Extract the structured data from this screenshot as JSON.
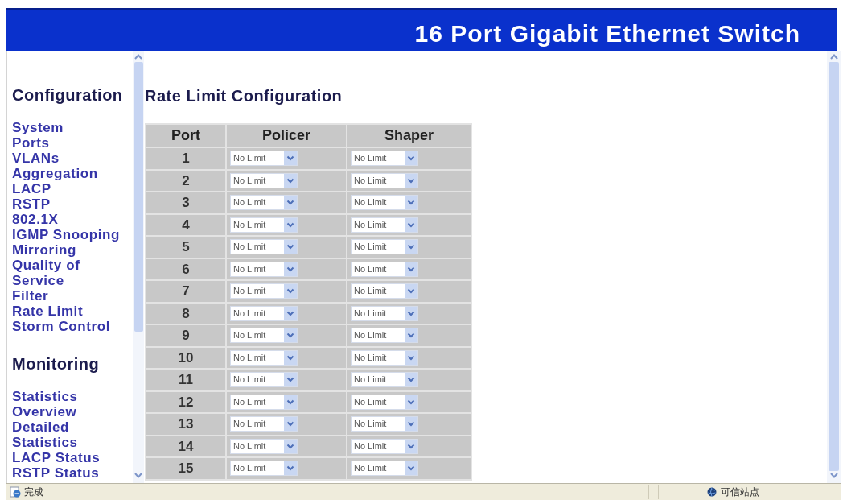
{
  "header": {
    "title": "16 Port Gigabit Ethernet Switch"
  },
  "sidebar": {
    "sections": [
      {
        "heading": "Configuration",
        "items": [
          "System",
          "Ports",
          "VLANs",
          "Aggregation",
          "LACP",
          "RSTP",
          "802.1X",
          "IGMP Snooping",
          "Mirroring",
          "Quality of Service",
          "Filter",
          "Rate Limit",
          "Storm Control"
        ]
      },
      {
        "heading": "Monitoring",
        "items": [
          "Statistics Overview",
          "Detailed Statistics",
          "LACP Status",
          "RSTP Status"
        ]
      }
    ]
  },
  "content": {
    "heading": "Rate Limit Configuration",
    "table": {
      "columns": [
        "Port",
        "Policer",
        "Shaper"
      ],
      "rows": [
        {
          "port": "1",
          "policer": "No Limit",
          "shaper": "No Limit"
        },
        {
          "port": "2",
          "policer": "No Limit",
          "shaper": "No Limit"
        },
        {
          "port": "3",
          "policer": "No Limit",
          "shaper": "No Limit"
        },
        {
          "port": "4",
          "policer": "No Limit",
          "shaper": "No Limit"
        },
        {
          "port": "5",
          "policer": "No Limit",
          "shaper": "No Limit"
        },
        {
          "port": "6",
          "policer": "No Limit",
          "shaper": "No Limit"
        },
        {
          "port": "7",
          "policer": "No Limit",
          "shaper": "No Limit"
        },
        {
          "port": "8",
          "policer": "No Limit",
          "shaper": "No Limit"
        },
        {
          "port": "9",
          "policer": "No Limit",
          "shaper": "No Limit"
        },
        {
          "port": "10",
          "policer": "No Limit",
          "shaper": "No Limit"
        },
        {
          "port": "11",
          "policer": "No Limit",
          "shaper": "No Limit"
        },
        {
          "port": "12",
          "policer": "No Limit",
          "shaper": "No Limit"
        },
        {
          "port": "13",
          "policer": "No Limit",
          "shaper": "No Limit"
        },
        {
          "port": "14",
          "policer": "No Limit",
          "shaper": "No Limit"
        },
        {
          "port": "15",
          "policer": "No Limit",
          "shaper": "No Limit"
        }
      ]
    }
  },
  "status_bar": {
    "status": "完成",
    "zone": "可信站点"
  }
}
